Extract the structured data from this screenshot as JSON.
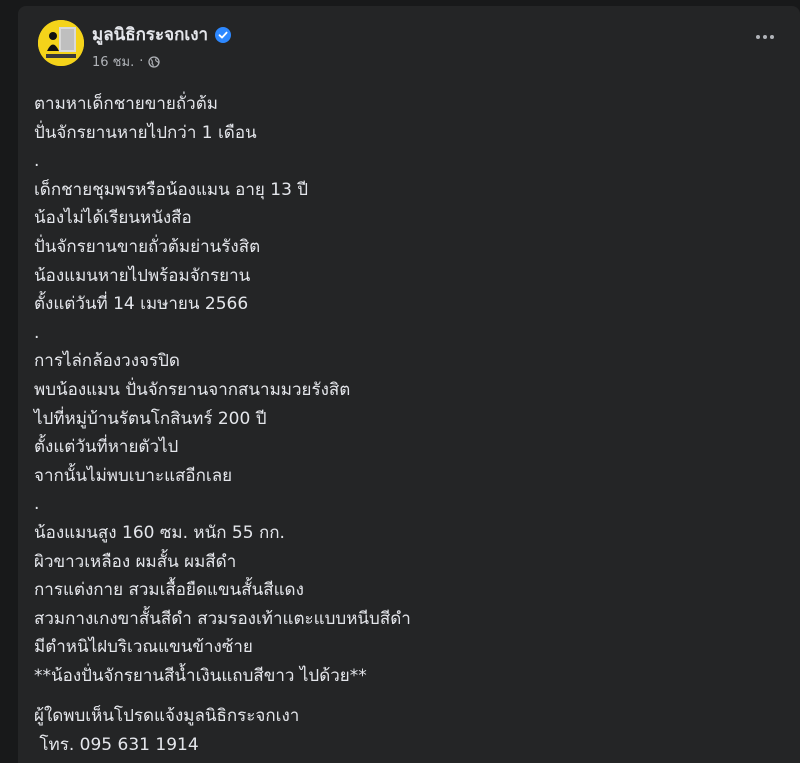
{
  "post": {
    "page_name": "มูลนิธิกระจกเงา",
    "timestamp": "16 ชม.",
    "separator": "·",
    "icons": {
      "verified": "verified-badge-icon",
      "audience": "globe-icon",
      "more": "more-options-icon"
    },
    "colors": {
      "background": "#242526",
      "text": "#e4e6eb",
      "secondary_text": "#b0b3b8",
      "verified": "#2d88ff",
      "avatar": "#f4d31a"
    },
    "lines": [
      "ตามหาเด็กชายขายถั่วต้ม",
      "ปั่นจักรยานหายไปกว่า 1 เดือน",
      ".",
      "เด็กชายชุมพรหรือน้องแมน อายุ 13 ปี",
      "น้องไม่ได้เรียนหนังสือ",
      "ปั่นจักรยานขายถั่วต้มย่านรังสิต",
      "น้องแมนหายไปพร้อมจักรยาน",
      "ตั้งแต่วันที่ 14 เมษายน 2566",
      ".",
      "การไล่กล้องวงจรปิด",
      "พบน้องแมน ปั่นจักรยานจากสนามมวยรังสิต",
      "ไปที่หมู่บ้านรัตนโกสินทร์ 200 ปี",
      "ตั้งแต่วันที่หายตัวไป",
      "จากนั้นไม่พบเบาะแสอีกเลย",
      ".",
      "น้องแมนสูง 160 ซม. หนัก 55 กก.",
      "ผิวขาวเหลือง ผมสั้น ผมสีดำ",
      "การแต่งกาย สวมเสื้อยืดแขนสั้นสีแดง",
      "สวมกางเกงขาสั้นสีดำ สวมรองเท้าแตะแบบหนีบสีดำ",
      "มีตำหนิไฝบริเวณแขนข้างซ้าย",
      "**น้องปั่นจักรยานสีน้ำเงินแถบสีขาว ไปด้วย**"
    ],
    "footer_lines": [
      "ผู้ใดพบเห็นโปรดแจ้งมูลนิธิกระจกเงา",
      " โทร. 095 631 1914"
    ]
  }
}
